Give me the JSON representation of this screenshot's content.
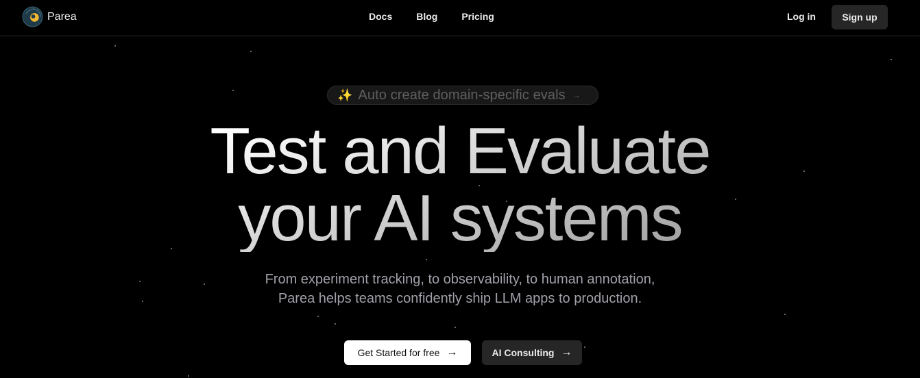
{
  "brand": {
    "name": "Parea",
    "logo_icon": "parea-spiral-logo"
  },
  "nav": {
    "links": [
      {
        "label": "Docs"
      },
      {
        "label": "Blog"
      },
      {
        "label": "Pricing"
      }
    ],
    "login_label": "Log in",
    "signup_label": "Sign up"
  },
  "announcement": {
    "icon": "sparkles-icon",
    "icon_glyph": "✨",
    "text": "Auto create domain-specific evals",
    "arrow": "→"
  },
  "hero": {
    "line1": "Test and Evaluate",
    "line2": "your AI systems",
    "subtitle_line1": "From experiment tracking, to observability, to human annotation,",
    "subtitle_line2": "Parea helps teams confidently ship LLM apps to production."
  },
  "cta": {
    "primary_label": "Get Started for free",
    "secondary_label": "AI Consulting",
    "arrow": "→"
  },
  "colors": {
    "background": "#000000",
    "accent_gold": "#b58a2a",
    "button_dark": "#262626",
    "subtitle": "#a1a1aa"
  }
}
